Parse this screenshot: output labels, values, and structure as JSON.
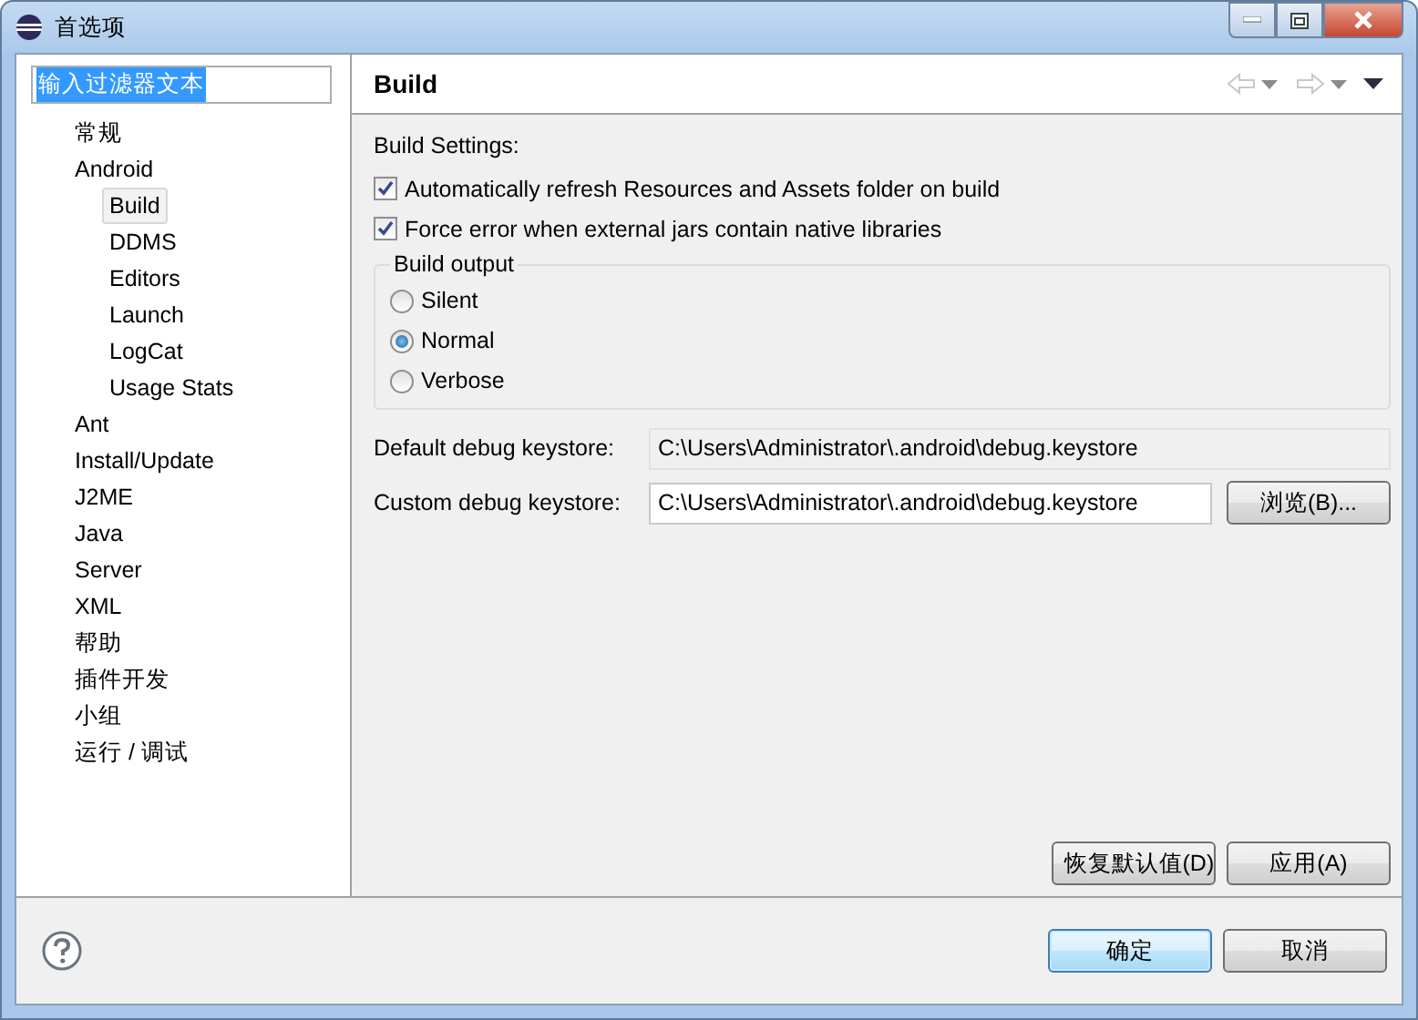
{
  "window": {
    "title": "首选项"
  },
  "filter": {
    "value": "输入过滤器文本"
  },
  "tree": [
    {
      "label": "常规",
      "selected": false
    },
    {
      "label": "Android",
      "selected": false,
      "children": [
        {
          "label": "Build",
          "selected": true
        },
        {
          "label": "DDMS",
          "selected": false
        },
        {
          "label": "Editors",
          "selected": false
        },
        {
          "label": "Launch",
          "selected": false
        },
        {
          "label": "LogCat",
          "selected": false
        },
        {
          "label": "Usage Stats",
          "selected": false
        }
      ]
    },
    {
      "label": "Ant",
      "selected": false
    },
    {
      "label": "Install/Update",
      "selected": false
    },
    {
      "label": "J2ME",
      "selected": false
    },
    {
      "label": "Java",
      "selected": false
    },
    {
      "label": "Server",
      "selected": false
    },
    {
      "label": "XML",
      "selected": false
    },
    {
      "label": "帮助",
      "selected": false
    },
    {
      "label": "插件开发",
      "selected": false
    },
    {
      "label": "小组",
      "selected": false
    },
    {
      "label": "运行 / 调试",
      "selected": false
    }
  ],
  "page": {
    "title": "Build",
    "settings_label": "Build Settings:",
    "checkboxes": [
      {
        "label": "Automatically refresh Resources and Assets folder on build",
        "checked": true
      },
      {
        "label": "Force error when external jars contain native libraries",
        "checked": true
      }
    ],
    "build_output": {
      "legend": "Build output",
      "options": [
        {
          "label": "Silent",
          "selected": false
        },
        {
          "label": "Normal",
          "selected": true
        },
        {
          "label": "Verbose",
          "selected": false
        }
      ]
    },
    "fields": [
      {
        "label": "Default debug keystore:",
        "value": "C:\\Users\\Administrator\\.android\\debug.keystore",
        "disabled": true
      },
      {
        "label": "Custom debug keystore:",
        "value": "C:\\Users\\Administrator\\.android\\debug.keystore",
        "disabled": false,
        "button": "浏览(B)..."
      }
    ],
    "buttons": [
      "恢复默认值(D)",
      "应用(A)"
    ]
  },
  "footer_buttons": [
    {
      "label": "确定",
      "default": true
    },
    {
      "label": "取消",
      "default": false
    }
  ]
}
